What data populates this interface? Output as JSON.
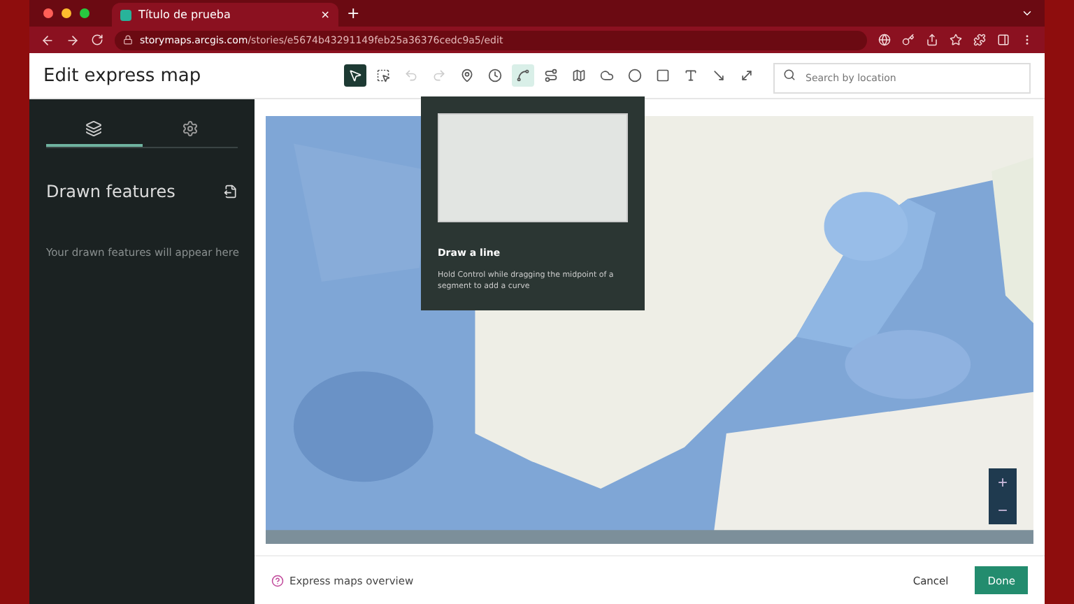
{
  "browser": {
    "tab_title": "Título de prueba",
    "tab_close": "×",
    "new_tab": "+",
    "url": "**storymaps.arcgis.com**/stories/e5674b43291149feb25a36376cedc9a5/edit"
  },
  "header": {
    "title": "Edit express map",
    "search": {
      "placeholder": "Search by location"
    },
    "tools": [
      {
        "kind": "pointer",
        "selected": true,
        "disabled": false,
        "hovered": false
      },
      {
        "kind": "marquee",
        "selected": false,
        "disabled": false,
        "hovered": false
      },
      {
        "kind": "undo",
        "selected": false,
        "disabled": true,
        "hovered": false
      },
      {
        "kind": "redo",
        "selected": false,
        "disabled": true,
        "hovered": false
      },
      {
        "kind": "pin",
        "selected": false,
        "disabled": false,
        "hovered": false
      },
      {
        "kind": "clock",
        "selected": false,
        "disabled": false,
        "hovered": false
      },
      {
        "kind": "line",
        "selected": false,
        "disabled": false,
        "hovered": true
      },
      {
        "kind": "route",
        "selected": false,
        "disabled": false,
        "hovered": false
      },
      {
        "kind": "area",
        "selected": false,
        "disabled": false,
        "hovered": false
      },
      {
        "kind": "blob",
        "selected": false,
        "disabled": false,
        "hovered": false
      },
      {
        "kind": "circle",
        "selected": false,
        "disabled": false,
        "hovered": false
      },
      {
        "kind": "square",
        "selected": false,
        "disabled": false,
        "hovered": false
      },
      {
        "kind": "text",
        "selected": false,
        "disabled": false,
        "hovered": false
      },
      {
        "kind": "arrow",
        "selected": false,
        "disabled": false,
        "hovered": false
      },
      {
        "kind": "double_arrow",
        "selected": false,
        "disabled": false,
        "hovered": false
      }
    ]
  },
  "sidebar": {
    "tabs": [
      {
        "kind": "layers",
        "selected": true
      },
      {
        "kind": "settings",
        "selected": false
      }
    ],
    "heading": "Drawn features",
    "empty_message": "Your drawn features will appear here"
  },
  "tooltip": {
    "title": "Draw a line",
    "body": "Hold Control while dragging the midpoint of a segment to add a curve"
  },
  "map": {
    "kind": "picture",
    "zoom_in": "+",
    "zoom_out": "−"
  },
  "footer": {
    "help_link": "Express maps overview",
    "buttons": [
      {
        "label": "Cancel",
        "kind": "secondary"
      },
      {
        "label": "Done",
        "kind": "primary"
      }
    ]
  }
}
